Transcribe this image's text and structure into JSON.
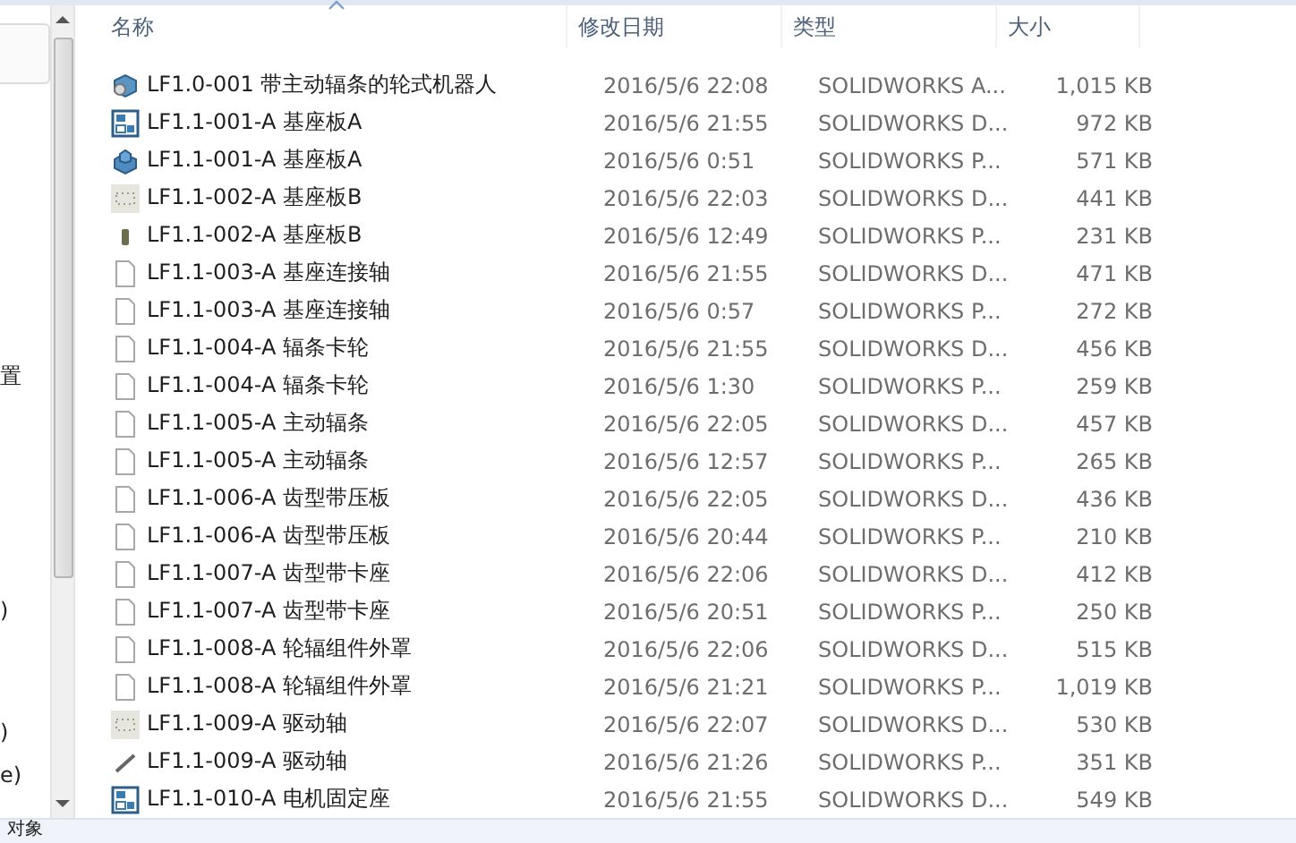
{
  "nav_pane": {
    "labels": [
      "置",
      ")",
      ")",
      "e)"
    ]
  },
  "columns": [
    {
      "label": "名称",
      "sorted": true
    },
    {
      "label": "修改日期",
      "sorted": false
    },
    {
      "label": "类型",
      "sorted": false
    },
    {
      "label": "大小",
      "sorted": false
    }
  ],
  "files": [
    {
      "kind": "assembly",
      "name": "LF1.0-001 带主动辐条的轮式机器人",
      "date": "2016/5/6 22:08",
      "type": "SOLIDWORKS A...",
      "size": "1,015 KB"
    },
    {
      "kind": "drawing",
      "name": "LF1.1-001-A 基座板A",
      "date": "2016/5/6 21:55",
      "type": "SOLIDWORKS D...",
      "size": "972 KB"
    },
    {
      "kind": "part",
      "name": "LF1.1-001-A 基座板A",
      "date": "2016/5/6 0:51",
      "type": "SOLIDWORKS P...",
      "size": "571 KB"
    },
    {
      "kind": "preview",
      "name": "LF1.1-002-A 基座板B",
      "date": "2016/5/6 22:03",
      "type": "SOLIDWORKS D...",
      "size": "441 KB"
    },
    {
      "kind": "block",
      "name": "LF1.1-002-A 基座板B",
      "date": "2016/5/6 12:49",
      "type": "SOLIDWORKS P...",
      "size": "231 KB"
    },
    {
      "kind": "blank",
      "name": "LF1.1-003-A 基座连接轴",
      "date": "2016/5/6 21:55",
      "type": "SOLIDWORKS D...",
      "size": "471 KB"
    },
    {
      "kind": "blank",
      "name": "LF1.1-003-A 基座连接轴",
      "date": "2016/5/6 0:57",
      "type": "SOLIDWORKS P...",
      "size": "272 KB"
    },
    {
      "kind": "blank",
      "name": "LF1.1-004-A 辐条卡轮",
      "date": "2016/5/6 21:55",
      "type": "SOLIDWORKS D...",
      "size": "456 KB"
    },
    {
      "kind": "blank",
      "name": "LF1.1-004-A 辐条卡轮",
      "date": "2016/5/6 1:30",
      "type": "SOLIDWORKS P...",
      "size": "259 KB"
    },
    {
      "kind": "blank",
      "name": "LF1.1-005-A 主动辐条",
      "date": "2016/5/6 22:05",
      "type": "SOLIDWORKS D...",
      "size": "457 KB"
    },
    {
      "kind": "blank",
      "name": "LF1.1-005-A 主动辐条",
      "date": "2016/5/6 12:57",
      "type": "SOLIDWORKS P...",
      "size": "265 KB"
    },
    {
      "kind": "blank",
      "name": "LF1.1-006-A 齿型带压板",
      "date": "2016/5/6 22:05",
      "type": "SOLIDWORKS D...",
      "size": "436 KB"
    },
    {
      "kind": "blank",
      "name": "LF1.1-006-A 齿型带压板",
      "date": "2016/5/6 20:44",
      "type": "SOLIDWORKS P...",
      "size": "210 KB"
    },
    {
      "kind": "blank",
      "name": "LF1.1-007-A 齿型带卡座",
      "date": "2016/5/6 22:06",
      "type": "SOLIDWORKS D...",
      "size": "412 KB"
    },
    {
      "kind": "blank",
      "name": "LF1.1-007-A 齿型带卡座",
      "date": "2016/5/6 20:51",
      "type": "SOLIDWORKS P...",
      "size": "250 KB"
    },
    {
      "kind": "blank",
      "name": "LF1.1-008-A 轮辐组件外罩",
      "date": "2016/5/6 22:06",
      "type": "SOLIDWORKS D...",
      "size": "515 KB"
    },
    {
      "kind": "blank",
      "name": "LF1.1-008-A 轮辐组件外罩",
      "date": "2016/5/6 21:21",
      "type": "SOLIDWORKS P...",
      "size": "1,019 KB"
    },
    {
      "kind": "preview",
      "name": "LF1.1-009-A 驱动轴",
      "date": "2016/5/6 22:07",
      "type": "SOLIDWORKS D...",
      "size": "530 KB"
    },
    {
      "kind": "shaft",
      "name": "LF1.1-009-A 驱动轴",
      "date": "2016/5/6 21:26",
      "type": "SOLIDWORKS P...",
      "size": "351 KB"
    },
    {
      "kind": "drawing",
      "name": "LF1.1-010-A 电机固定座",
      "date": "2016/5/6 21:55",
      "type": "SOLIDWORKS D...",
      "size": "549 KB"
    }
  ],
  "status_bar": {
    "text": "对象"
  }
}
